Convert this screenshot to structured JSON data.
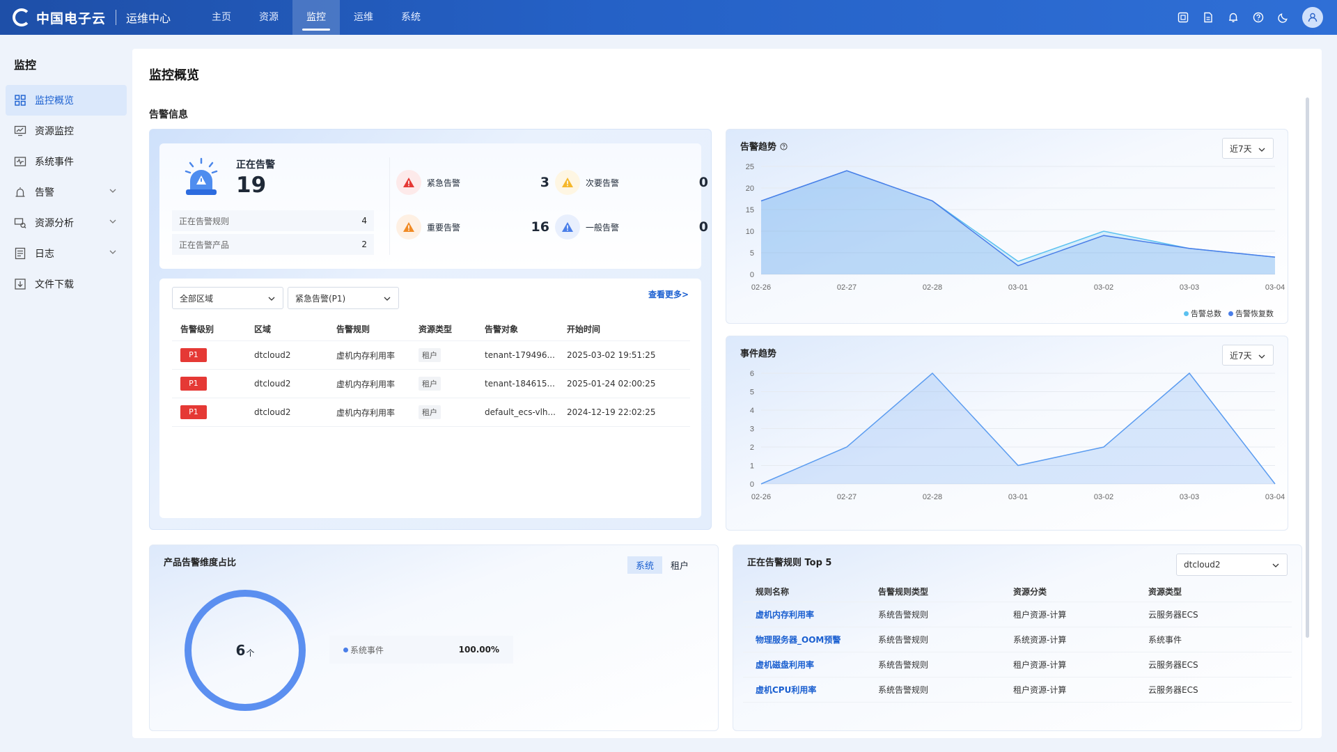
{
  "header": {
    "brand": "中国电子云",
    "subtitle": "运维中心",
    "nav": [
      {
        "label": "主页"
      },
      {
        "label": "资源"
      },
      {
        "label": "监控"
      },
      {
        "label": "运维"
      },
      {
        "label": "系统"
      }
    ],
    "active_nav": "监控",
    "accent": "#1e4fa8"
  },
  "sidebar": {
    "title": "监控",
    "items": [
      {
        "label": "监控概览",
        "icon": "grid-icon"
      },
      {
        "label": "资源监控",
        "icon": "monitor-icon"
      },
      {
        "label": "系统事件",
        "icon": "event-icon"
      },
      {
        "label": "告警",
        "icon": "alarm-icon"
      },
      {
        "label": "资源分析",
        "icon": "analysis-icon"
      },
      {
        "label": "日志",
        "icon": "log-icon"
      },
      {
        "label": "文件下载",
        "icon": "download-icon"
      }
    ]
  },
  "main": {
    "title": "监控概览",
    "section": "告警信息"
  },
  "alarm": {
    "title": "正在告警",
    "count": "19",
    "rules_label": "正在告警规则",
    "rules_value": "4",
    "products_label": "正在告警产品",
    "products_value": "2",
    "levels": [
      {
        "label": "紧急告警",
        "value": "3",
        "color": "#e53935"
      },
      {
        "label": "次要告警",
        "value": "0",
        "color": "#f5b72a"
      },
      {
        "label": "重要告警",
        "value": "16",
        "color": "#f08a24"
      },
      {
        "label": "一般告警",
        "value": "0",
        "color": "#4a7ee8"
      }
    ]
  },
  "alarm_list": {
    "region_select": "全部区域",
    "level_select": "紧急告警(P1)",
    "more": "查看更多>",
    "headers": [
      "告警级别",
      "区域",
      "告警规则",
      "资源类型",
      "告警对象",
      "开始时间"
    ],
    "rows": [
      [
        "P1",
        "dtcloud2",
        "虚机内存利用率",
        "租户",
        "tenant-179496...",
        "2025-03-02 19:51:25"
      ],
      [
        "P1",
        "dtcloud2",
        "虚机内存利用率",
        "租户",
        "tenant-184615...",
        "2025-01-24 02:00:25"
      ],
      [
        "P1",
        "dtcloud2",
        "虚机内存利用率",
        "租户",
        "default_ecs-vlh...",
        "2024-12-19 22:02:25"
      ]
    ]
  },
  "trend": {
    "title": "告警趋势",
    "range": "近7天",
    "legend": [
      "告警总数",
      "告警恢复数"
    ]
  },
  "event": {
    "title": "事件趋势",
    "range": "近7天"
  },
  "chart_data": [
    {
      "type": "area",
      "title": "告警趋势",
      "x": [
        "02-26",
        "02-27",
        "02-28",
        "03-01",
        "03-02",
        "03-03",
        "03-04"
      ],
      "ylim": [
        0,
        25
      ],
      "yticks": [
        0,
        5,
        10,
        15,
        20,
        25
      ],
      "series": [
        {
          "name": "告警总数",
          "values": [
            17,
            24,
            17,
            3,
            10,
            6,
            4
          ]
        },
        {
          "name": "告警恢复数",
          "values": [
            17,
            24,
            17,
            2,
            9,
            6,
            4
          ]
        }
      ],
      "legend_position": "bottom-right",
      "grid": true
    },
    {
      "type": "area",
      "title": "事件趋势",
      "x": [
        "02-26",
        "02-27",
        "02-28",
        "03-01",
        "03-02",
        "03-03",
        "03-04"
      ],
      "ylim": [
        0,
        6
      ],
      "yticks": [
        0,
        1,
        2,
        3,
        4,
        5,
        6
      ],
      "series": [
        {
          "values": [
            0,
            2,
            6,
            1,
            2,
            6,
            0
          ]
        }
      ],
      "grid": true
    }
  ],
  "product_ratio": {
    "title": "产品告警维度占比",
    "tabs": [
      "系统",
      "租户"
    ],
    "active_tab": "系统",
    "total": "6",
    "unit": "个",
    "legend_label": "系统事件",
    "legend_value": "100.00%",
    "ring_fraction": 1.0
  },
  "top5": {
    "title": "正在告警规则 Top 5",
    "region": "dtcloud2",
    "headers": [
      "规则名称",
      "告警规则类型",
      "资源分类",
      "资源类型"
    ],
    "rows": [
      [
        "虚机内存利用率",
        "系统告警规则",
        "租户资源-计算",
        "云服务器ECS"
      ],
      [
        "物理服务器_OOM预警",
        "系统告警规则",
        "系统资源-计算",
        "系统事件"
      ],
      [
        "虚机磁盘利用率",
        "系统告警规则",
        "租户资源-计算",
        "云服务器ECS"
      ],
      [
        "虚机CPU利用率",
        "系统告警规则",
        "租户资源-计算",
        "云服务器ECS"
      ]
    ]
  }
}
